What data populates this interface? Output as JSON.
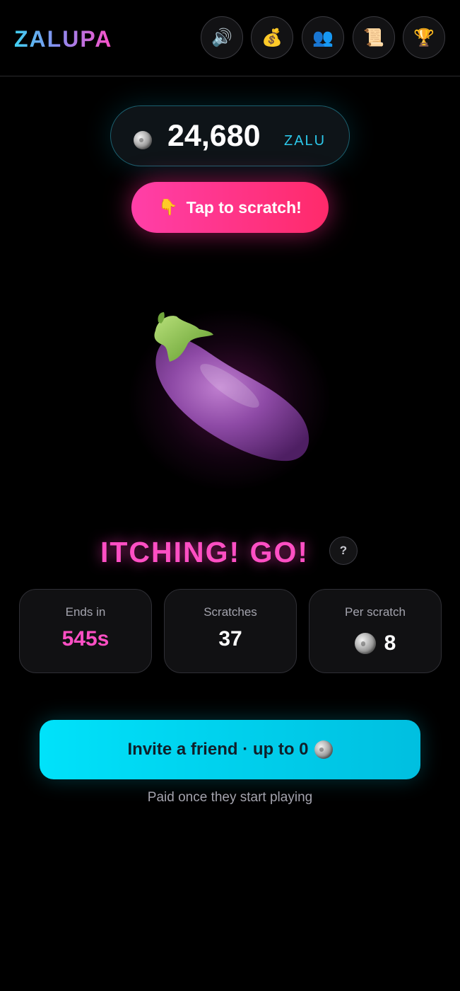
{
  "header": {
    "logo": "ZALUPA",
    "buttons": [
      {
        "name": "sound",
        "glyph": "🔊"
      },
      {
        "name": "money-bag",
        "glyph": "💰"
      },
      {
        "name": "friends",
        "glyph": "👥"
      },
      {
        "name": "scroll",
        "glyph": "📜"
      },
      {
        "name": "trophy",
        "glyph": "🏆"
      }
    ]
  },
  "balance": {
    "amount": "24,680",
    "unit": "ZALU"
  },
  "scratch_button": {
    "emoji": "👇",
    "label": "Tap to scratch!"
  },
  "character": {
    "icon": "eggplant-icon"
  },
  "status": {
    "text": "ITCHING! GO!",
    "help": "?"
  },
  "stats": {
    "ends_in": {
      "label": "Ends in",
      "value": "545s"
    },
    "scratches": {
      "label": "Scratches",
      "value": "37"
    },
    "per_scratch": {
      "label": "Per scratch",
      "value": "8"
    }
  },
  "invite": {
    "label": "Invite a friend · up to 0",
    "note": "Paid once they start playing"
  },
  "colors": {
    "accent_pink": "#ff4fc4",
    "accent_cyan": "#00d2f0",
    "background": "#000000"
  }
}
